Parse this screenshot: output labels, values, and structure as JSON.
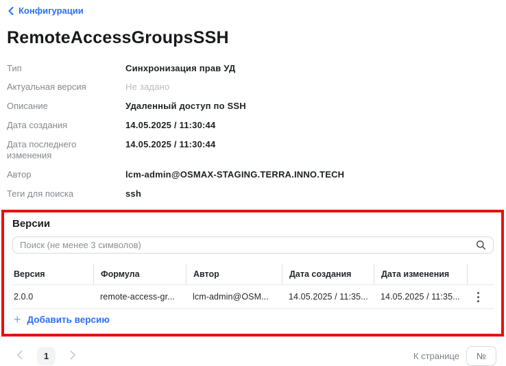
{
  "page": {
    "back_link": "Конфигурации",
    "title": "RemoteAccessGroupsSSH"
  },
  "details": {
    "rows": [
      {
        "label": "Тип",
        "value": "Синхронизация прав УД"
      },
      {
        "label": "Актуальная версия",
        "value": "Не задано"
      },
      {
        "label": "Описание",
        "value": "Удаленный доступ по SSH"
      },
      {
        "label": "Дата создания",
        "value": "14.05.2025 / 11:30:44"
      },
      {
        "label": "Дата последнего изменения",
        "value": "14.05.2025 / 11:30:44"
      },
      {
        "label": "Автор",
        "value": "lcm-admin@OSMAX-STAGING.TERRA.INNO.TECH"
      },
      {
        "label": "Теги для поиска",
        "value": "ssh"
      }
    ]
  },
  "versions": {
    "title": "Версии",
    "search_placeholder": "Поиск (не менее 3 символов)",
    "table": {
      "headers": [
        "Версия",
        "Формула",
        "Автор",
        "Дата создания",
        "Дата изменения"
      ],
      "rows": [
        {
          "cells": [
            "2.0.0",
            "remote-access-gr...",
            "lcm-admin@OSM...",
            "14.05.2025 / 11:35...",
            "14.05.2025 / 11:35..."
          ]
        }
      ]
    },
    "add_button_label": "Добавить версию",
    "highlight_color": "#e8100c"
  },
  "pagination": {
    "current_page": "1",
    "goto_label": "К странице",
    "goto_placeholder": "№"
  },
  "colors": {
    "accent_blue": "#2a6ff2",
    "highlight_red": "#e8100c",
    "label_gray": "#84888e"
  },
  "icons": {
    "back": "chevron-left-icon",
    "search": "search-icon",
    "row_menu": "kebab-menu-icon",
    "prev": "chevron-left-icon",
    "next": "chevron-right-icon",
    "add": "plus-icon"
  }
}
